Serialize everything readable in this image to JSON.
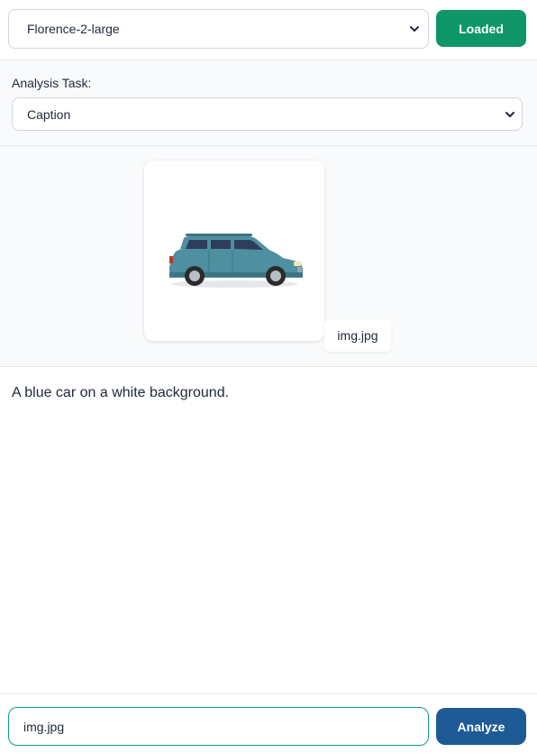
{
  "model": {
    "selected": "Florence-2-large",
    "status_label": "Loaded",
    "status_color": "#0f9668"
  },
  "task": {
    "label": "Analysis Task:",
    "selected": "Caption"
  },
  "image": {
    "filename": "img.jpg",
    "icon": "car-thumbnail"
  },
  "result": {
    "text": "A blue car on a white background."
  },
  "input": {
    "value": "img.jpg"
  },
  "actions": {
    "analyze_label": "Analyze",
    "analyze_color": "#1e5a96"
  }
}
